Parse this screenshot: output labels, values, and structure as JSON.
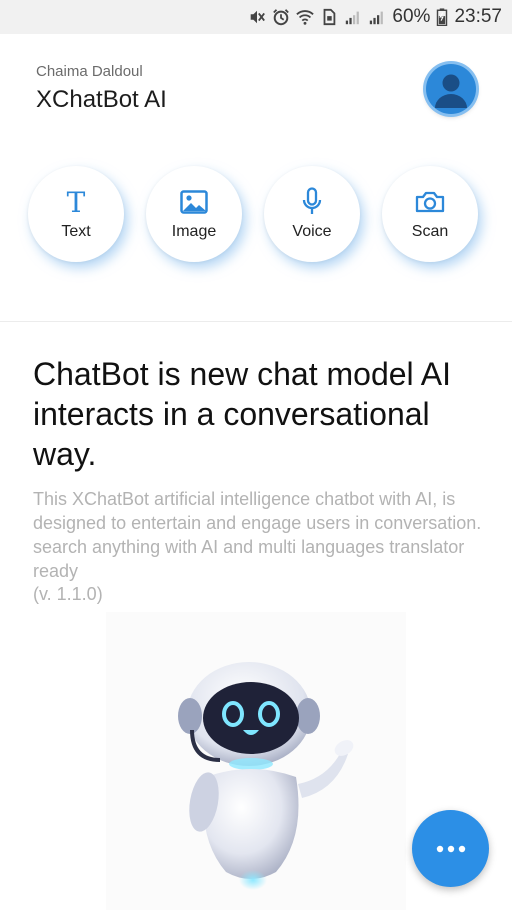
{
  "status_bar": {
    "battery_percent": "60%",
    "time": "23:57",
    "icons": [
      "mute-icon",
      "alarm-icon",
      "wifi-icon",
      "sim-icon",
      "signal-icon",
      "signal-icon",
      "battery-icon"
    ]
  },
  "header": {
    "author": "Chaima Daldoul",
    "title": "XChatBot AI",
    "avatar_icon": "user-avatar-icon"
  },
  "modes": [
    {
      "label": "Text",
      "icon": "text-icon",
      "glyph": "T"
    },
    {
      "label": "Image",
      "icon": "image-icon"
    },
    {
      "label": "Voice",
      "icon": "microphone-icon"
    },
    {
      "label": "Scan",
      "icon": "camera-icon"
    }
  ],
  "content": {
    "headline": "ChatBot is new chat model AI interacts in a conversational way.",
    "description": "This XChatBot artificial intelligence chatbot with AI, is designed to entertain and engage users in conversation. search anything with AI and multi languages translator ready",
    "version": "(v. 1.1.0)"
  },
  "fab": {
    "icon": "more-dots-icon"
  },
  "colors": {
    "accent": "#2c88d9",
    "fab": "#2c8fe6",
    "headline": "#111111",
    "description": "#b3b3b3",
    "status_bar_bg": "#f1f1f1"
  }
}
